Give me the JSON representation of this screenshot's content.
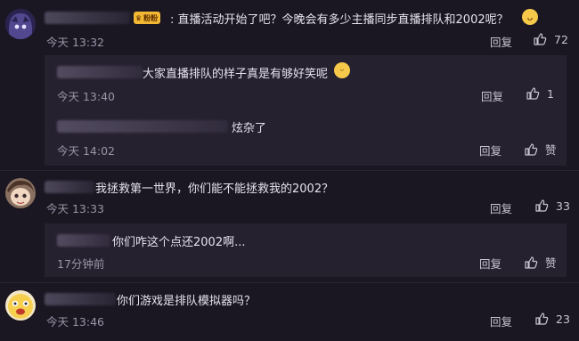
{
  "comments": [
    {
      "text": "直播活动开始了吧？今晚会有多少主播同步直播排队和2002呢？",
      "badge": "粉粉",
      "time": "今天 13:32",
      "reply": "回复",
      "likes": "72",
      "replies": [
        {
          "text": "大家直播排队的样子真是有够好笑呢",
          "time": "今天 13:40",
          "reply": "回复",
          "likes": "1"
        },
        {
          "text": "炫杂了",
          "time": "今天 14:02",
          "reply": "回复",
          "likes": "赞"
        }
      ]
    },
    {
      "text": "我拯救第一世界，你们能不能拯救我的2002？",
      "time": "今天 13:33",
      "reply": "回复",
      "likes": "33",
      "replies": [
        {
          "text": "你们咋这个点还2002啊...",
          "time": "17分钟前",
          "reply": "回复",
          "likes": "赞"
        }
      ]
    },
    {
      "text": "你们游戏是排队模拟器吗？",
      "time": "今天 13:46",
      "reply": "回复",
      "likes": "23",
      "replies": []
    }
  ],
  "colors": {
    "background": "#1a1722",
    "reply_box": "#26212f",
    "text": "#e6e2ee",
    "meta": "#9a95a8"
  },
  "icons": [
    "thumbs-up-icon",
    "emoji-icon",
    "fan-badge-icon"
  ]
}
